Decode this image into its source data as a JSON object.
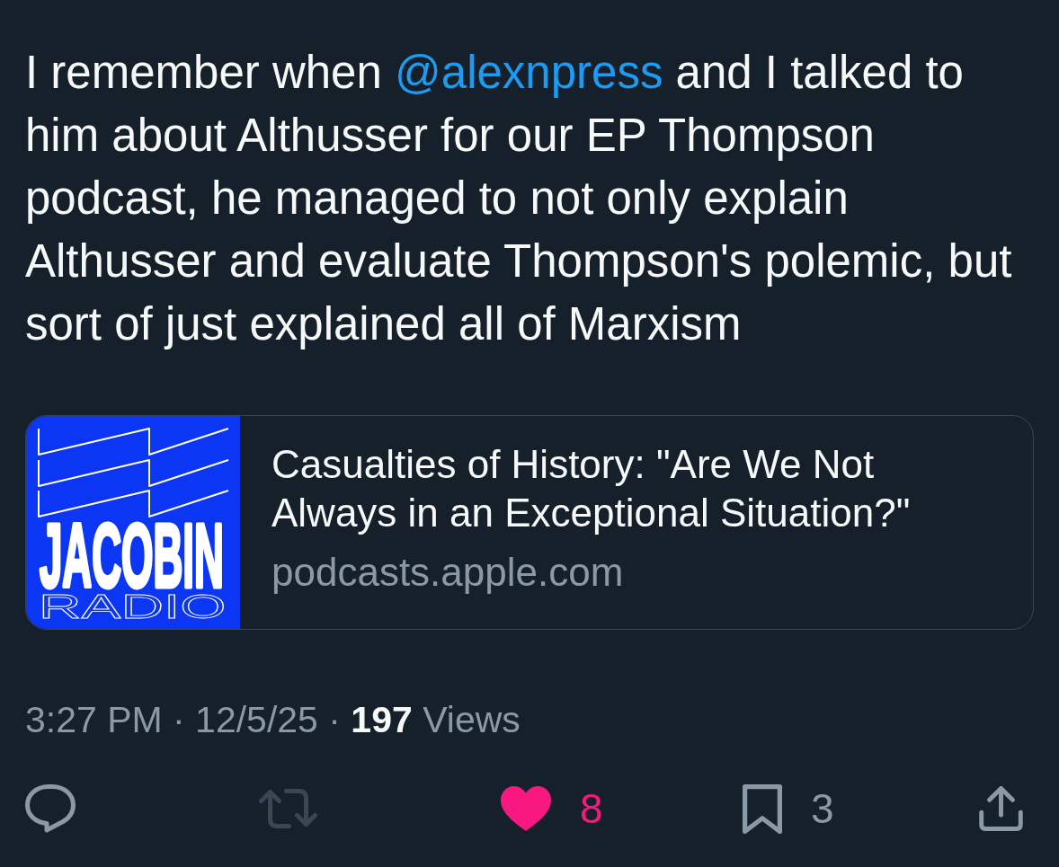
{
  "post": {
    "text": [
      {
        "kind": "plain",
        "text": "I remember when "
      },
      {
        "kind": "mention",
        "text": "@alexnpress"
      },
      {
        "kind": "plain",
        "text": " and I talked to him about Althusser for our EP Thompson podcast, he managed to not only explain Althusser and evaluate Thompson's polemic, but sort of just explained all of Marxism"
      }
    ]
  },
  "link_card": {
    "thumbnail": {
      "title": "JACOBIN",
      "subtitle": "RADIO"
    },
    "title": "Casualties of History: \"Are We Not Always in an Exceptional Situation?\"",
    "domain": "podcasts.apple.com"
  },
  "details": "3:27 PM · 12/5/25 · **197** Views",
  "actions": [
    {
      "kind": "reply",
      "on": false,
      "disabled": false
    },
    {
      "kind": "repost",
      "on": false,
      "disabled": true
    },
    {
      "kind": "like",
      "on": true,
      "disabled": false,
      "count": "8"
    },
    {
      "kind": "bookmark",
      "on": false,
      "disabled": false,
      "count": "3"
    },
    {
      "kind": "share",
      "on": false,
      "disabled": false
    }
  ]
}
